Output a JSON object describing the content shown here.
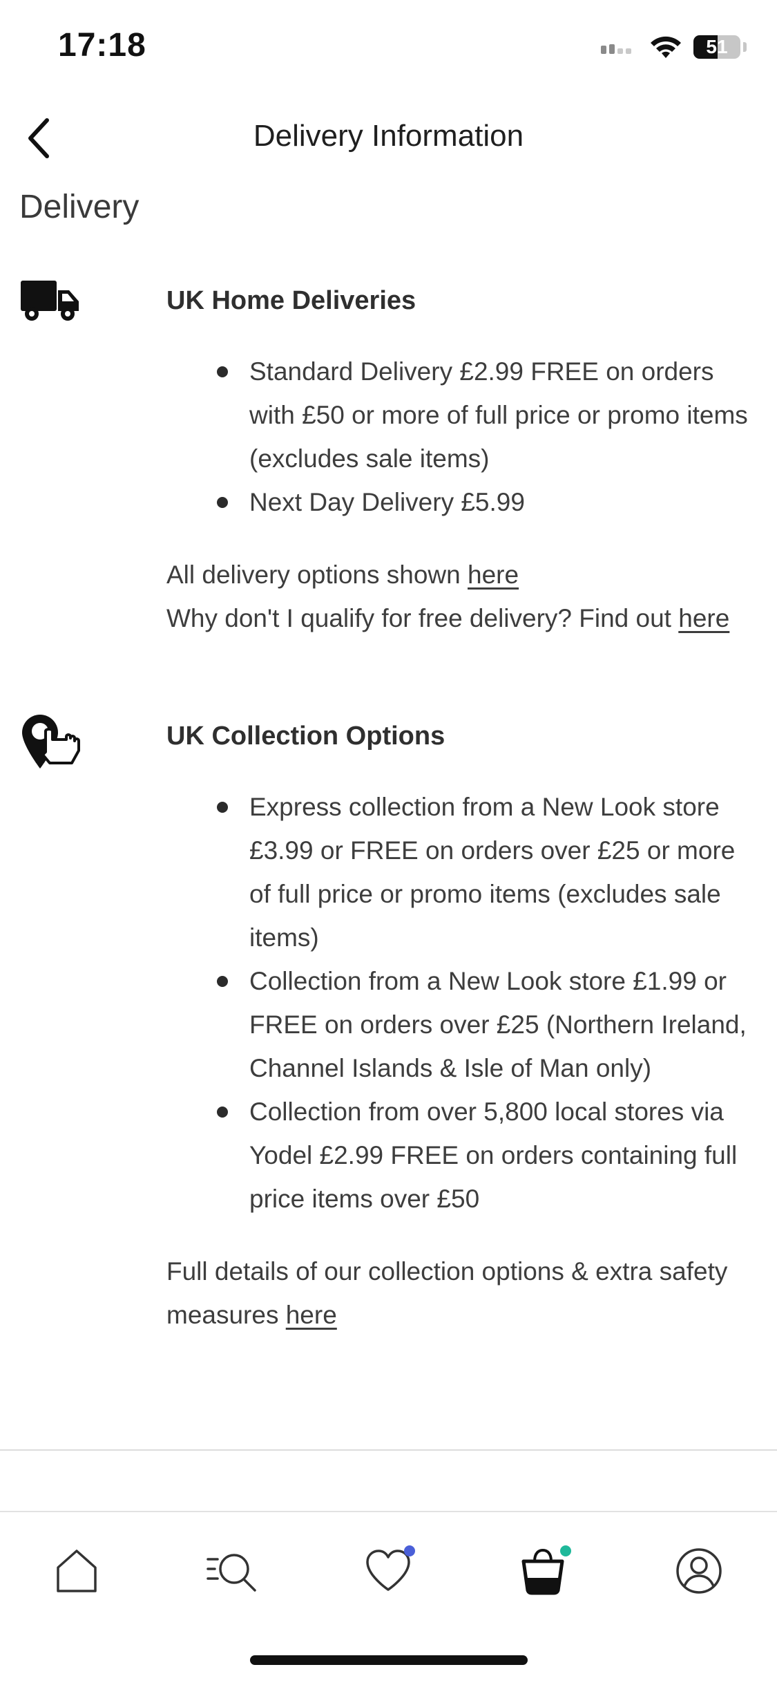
{
  "status_bar": {
    "time": "17:18",
    "battery_level": "51"
  },
  "header": {
    "title": "Delivery Information"
  },
  "section": {
    "heading": "Delivery"
  },
  "home_deliveries": {
    "icon": "truck-icon",
    "title": "UK Home Deliveries",
    "bullets": [
      "Standard Delivery £2.99 FREE on orders with £50 or more of full price or promo items (excludes sale items)",
      "Next Day Delivery £5.99"
    ],
    "options_text": "All delivery options shown ",
    "options_link": "here",
    "qualify_text": "Why don't I qualify for free delivery? Find out ",
    "qualify_link": "here"
  },
  "collection_options": {
    "icon": "location-pin-hand-icon",
    "title": "UK Collection Options",
    "bullets": [
      "Express collection from a New Look store £3.99 or FREE on orders over £25 or more of full price or promo items (excludes sale items)",
      "Collection from a New Look store £1.99 or FREE on orders over £25 (Northern Ireland, Channel Islands & Isle of Man only)",
      "Collection from over 5,800 local stores via Yodel £2.99 FREE on orders containing full price items over £50"
    ],
    "details_text": "Full details of our collection options & extra safety measures ",
    "details_link": "here"
  },
  "tab_bar": {
    "items": [
      {
        "name": "home",
        "icon": "home-icon"
      },
      {
        "name": "search",
        "icon": "search-icon"
      },
      {
        "name": "wishlist",
        "icon": "heart-icon"
      },
      {
        "name": "bag",
        "icon": "shopping-bag-icon"
      },
      {
        "name": "account",
        "icon": "user-icon"
      }
    ],
    "wishlist_badge_color": "#4a5fd8",
    "bag_badge_color": "#1fb89a"
  },
  "colors": {
    "text": "#2b2b2b",
    "background": "#ffffff",
    "divider": "#dcdcdc"
  }
}
